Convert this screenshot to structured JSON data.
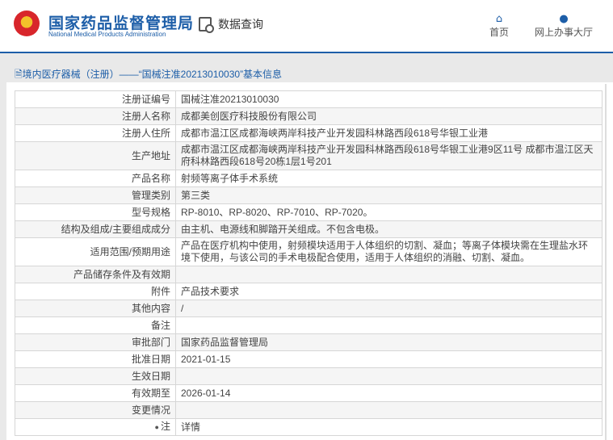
{
  "header": {
    "org_cn": "国家药品监督管理局",
    "org_en": "National Medical Products Administration",
    "query": "数据查询",
    "nav": [
      {
        "label": "首页",
        "icon": "home-icon"
      },
      {
        "label": "网上办事大厅",
        "icon": "user-icon"
      }
    ]
  },
  "panel": {
    "title": "境内医疗器械（注册）——“国械注准20213010030”基本信息"
  },
  "rows": [
    {
      "label": "注册证编号",
      "value": "国械注准20213010030"
    },
    {
      "label": "注册人名称",
      "value": "成都美创医疗科技股份有限公司"
    },
    {
      "label": "注册人住所",
      "value": "成都市温江区成都海峡两岸科技产业开发园科林路西段618号华银工业港"
    },
    {
      "label": "生产地址",
      "value": "成都市温江区成都海峡两岸科技产业开发园科林路西段618号华银工业港9区11号 成都市温江区天府科林路西段618号20栋1层1号201"
    },
    {
      "label": "产品名称",
      "value": "射频等离子体手术系统"
    },
    {
      "label": "管理类别",
      "value": "第三类"
    },
    {
      "label": "型号规格",
      "value": "RP-8010、RP-8020、RP-7010、RP-7020。"
    },
    {
      "label": "结构及组成/主要组成成分",
      "value": "由主机、电源线和脚踏开关组成。不包含电极。"
    },
    {
      "label": "适用范围/预期用途",
      "value": "产品在医疗机构中使用，射频模块适用于人体组织的切割、凝血；等离子体模块需在生理盐水环境下使用，与该公司的手术电极配合使用，适用于人体组织的消融、切割、凝血。"
    },
    {
      "label": "产品储存条件及有效期",
      "value": ""
    },
    {
      "label": "附件",
      "value": "产品技术要求"
    },
    {
      "label": "其他内容",
      "value": "/"
    },
    {
      "label": "备注",
      "value": ""
    },
    {
      "label": "审批部门",
      "value": "国家药品监督管理局"
    },
    {
      "label": "批准日期",
      "value": "2021-01-15"
    },
    {
      "label": "生效日期",
      "value": ""
    },
    {
      "label": "有效期至",
      "value": "2026-01-14"
    },
    {
      "label": "变更情况",
      "value": ""
    },
    {
      "label": "注",
      "value": "详情"
    }
  ]
}
